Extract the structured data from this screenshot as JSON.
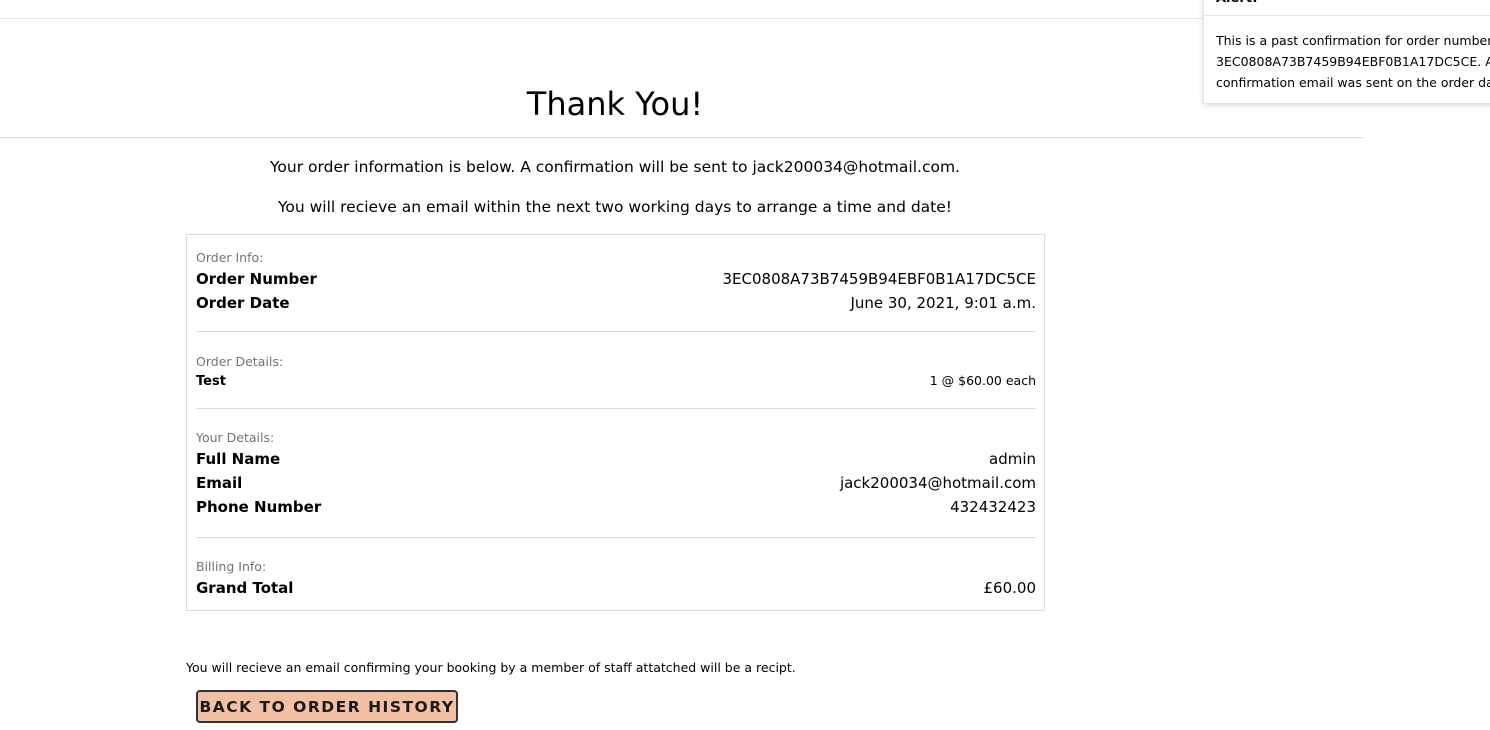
{
  "header": {
    "title": "Thank You!"
  },
  "intro": {
    "line1": "Your order information is below. A confirmation will be sent to jack200034@hotmail.com.",
    "line2": "You will recieve an email within the next two working days to arrange a time and date!"
  },
  "order_info": {
    "label": "Order Info:",
    "rows": [
      {
        "key": "Order Number",
        "value": "3EC0808A73B7459B94EBF0B1A17DC5CE"
      },
      {
        "key": "Order Date",
        "value": "June 30, 2021, 9:01 a.m."
      }
    ]
  },
  "order_details": {
    "label": "Order Details:",
    "items": [
      {
        "name": "Test",
        "quantity_text": "1 @ $60.00 each"
      }
    ]
  },
  "your_details": {
    "label": "Your Details:",
    "rows": [
      {
        "key": "Full Name",
        "value": "admin"
      },
      {
        "key": "Email",
        "value": "jack200034@hotmail.com"
      },
      {
        "key": "Phone Number",
        "value": "432432423"
      }
    ]
  },
  "billing_info": {
    "label": "Billing Info:",
    "rows": [
      {
        "key": "Grand Total",
        "value": "£60.00"
      }
    ]
  },
  "footnote": "You will recieve an email confirming your booking by a member of staff attatched will be a recipt.",
  "back_button": {
    "label": "BACK TO ORDER HISTORY"
  },
  "alert": {
    "title": "Alert!",
    "body_line1": "This is a past confirmation for order number",
    "body_line2": "3EC0808A73B7459B94EBF0B1A17DC5CE. A",
    "body_line3": "confirmation email was sent on the order date."
  },
  "colors": {
    "button_bg": "#f4c0a4",
    "button_border": "#333333",
    "muted_label": "#6c757d",
    "rule": "#dcdcdc"
  }
}
